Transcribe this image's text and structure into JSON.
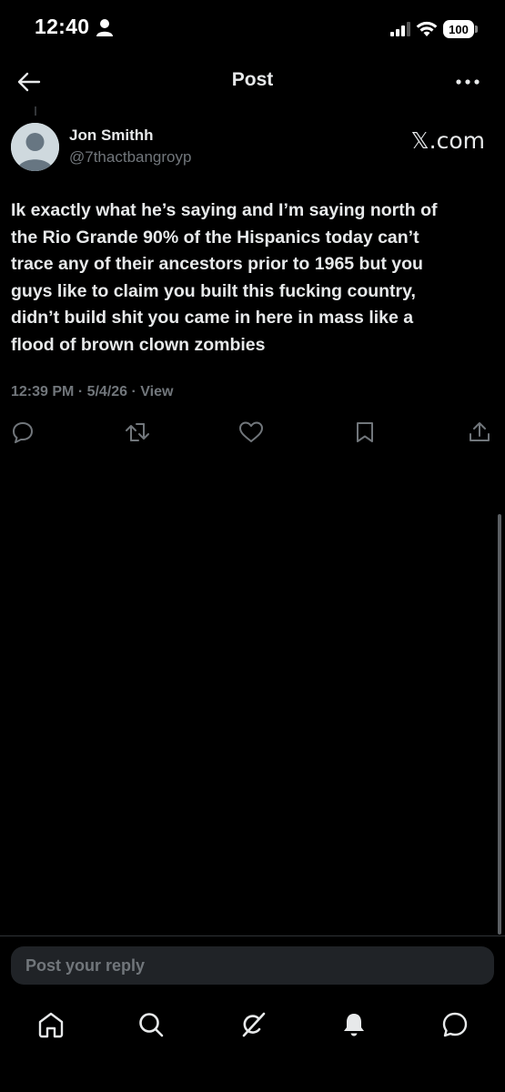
{
  "status_bar": {
    "time": "12:40",
    "battery": "100"
  },
  "header": {
    "title": "Post"
  },
  "post": {
    "author_name": "Jon Smithh",
    "author_handle": "@7thactbangroyp",
    "source": "𝕏.com",
    "text": "Ik exactly what he’s saying and I’m saying north of\nthe Rio Grande 90% of the Hispanics today can’t\ntrace any of their ancestors prior to 1965 but you\nguys like to claim you built this fucking country,\ndidn’t build shit you came in here in mass like a\nflood of brown clown zombies",
    "meta": "12:39 PM · 5/4/26 · View"
  },
  "actions": [
    {
      "icon": "reply-icon"
    },
    {
      "icon": "repost-icon"
    },
    {
      "icon": "like-icon"
    },
    {
      "icon": "bookmark-icon"
    },
    {
      "icon": "share-icon"
    }
  ],
  "composer": {
    "placeholder": "Post your reply"
  },
  "nav": [
    {
      "icon": "home-icon"
    },
    {
      "icon": "search-icon"
    },
    {
      "icon": "grok-icon"
    },
    {
      "icon": "notifications-icon"
    },
    {
      "icon": "messages-icon"
    }
  ],
  "colors": {
    "background": "#000000",
    "text_primary": "#e7e9ea",
    "text_secondary": "#71767b",
    "composer_bg": "#202327"
  }
}
